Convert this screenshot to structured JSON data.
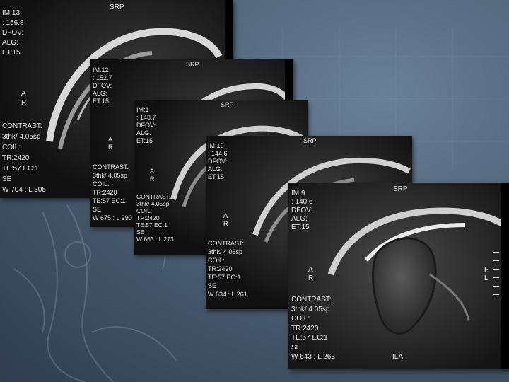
{
  "slides": [
    {
      "id": "im13",
      "im": "IM:13",
      "pos": ": 156.8",
      "dfov": "DFOV:",
      "alg": "ALG:",
      "et": "ET:15",
      "srp": "SRP",
      "a": "A",
      "r": "R",
      "contrast": "CONTRAST:",
      "thk": "3thk/ 4.05sp",
      "coil": "COIL:",
      "tr": "TR:2420",
      "te": "TE:57 EC:1",
      "se": "SE",
      "wl": "W 704 : L 305"
    },
    {
      "id": "im12",
      "im": "IM:12",
      "pos": ": 152.7",
      "dfov": "DFOV:",
      "alg": "ALG:",
      "et": "ET:15",
      "srp": "SRP",
      "a": "A",
      "r": "R",
      "contrast": "CONTRAST:",
      "thk": "3thk/ 4.05sp",
      "coil": "COIL:",
      "tr": "TR:2420",
      "te": "TE:57 EC:1",
      "se": "SE",
      "wl": "W 675 : L 290"
    },
    {
      "id": "im11",
      "im": "IM:1",
      "pos": ": 148.7",
      "dfov": "DFOV:",
      "alg": "ALG:",
      "et": "ET:15",
      "srp": "SRP",
      "a": "A",
      "r": "R",
      "contrast": "CONTRAST:",
      "thk": "3thk/ 4.05sp",
      "coil": "COIL:",
      "tr": "TR:2420",
      "te": "TE:57 EC:1",
      "se": "SE",
      "wl": "W 663 : L 273"
    },
    {
      "id": "im10",
      "im": "IM:10",
      "pos": ": 144.6",
      "dfov": "DFOV:",
      "alg": "ALG:",
      "et": "ET:15",
      "srp": "SRP",
      "a": "A",
      "r": "R",
      "contrast": "CONTRAST:",
      "thk": "3thk/ 4.05sp",
      "coil": "COIL:",
      "tr": "TR:2420",
      "te": "TE:57 EC:1",
      "se": "SE",
      "wl": "W 634 : L 261"
    },
    {
      "id": "im9",
      "im": "IM:9",
      "pos": ": 140.6",
      "dfov": "DFOV:",
      "alg": "ALG:",
      "et": "ET:15",
      "srp": "SRP",
      "a": "A",
      "r": "R",
      "p": "P",
      "l": "L",
      "ila": "ILA",
      "contrast": "CONTRAST:",
      "thk": "3thk/ 4.05sp",
      "coil": "COIL:",
      "tr": "TR:2420",
      "te": "TE:57 EC:1",
      "se": "SE",
      "wl": "W 643 : L 263"
    }
  ]
}
